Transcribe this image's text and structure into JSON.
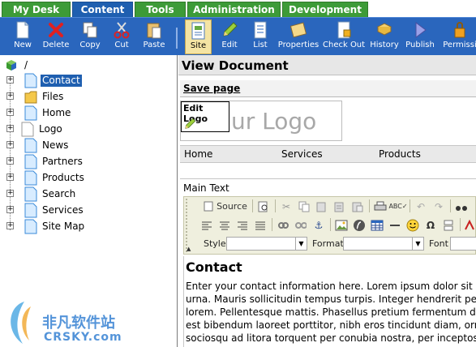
{
  "tabs": [
    {
      "label": "My Desk",
      "active": false
    },
    {
      "label": "Content",
      "active": true
    },
    {
      "label": "Tools",
      "active": false
    },
    {
      "label": "Administration",
      "active": false
    },
    {
      "label": "Development",
      "active": false
    }
  ],
  "toolbar": [
    {
      "label": "New",
      "icon": "new-page-icon"
    },
    {
      "label": "Delete",
      "icon": "delete-icon"
    },
    {
      "label": "Copy",
      "icon": "copy-icon"
    },
    {
      "label": "Cut",
      "icon": "cut-icon"
    },
    {
      "label": "Paste",
      "icon": "paste-icon"
    },
    {
      "label": "Site",
      "icon": "site-icon",
      "active": true
    },
    {
      "label": "Edit",
      "icon": "edit-icon"
    },
    {
      "label": "List",
      "icon": "list-icon"
    },
    {
      "label": "Properties",
      "icon": "properties-icon"
    },
    {
      "label": "Check Out",
      "icon": "check-out-icon"
    },
    {
      "label": "History",
      "icon": "history-icon"
    },
    {
      "label": "Publish",
      "icon": "publish-icon"
    },
    {
      "label": "Permissi",
      "icon": "permissions-icon"
    }
  ],
  "tree": {
    "root_label": "/",
    "items": [
      {
        "label": "Contact",
        "selected": true,
        "type": "page"
      },
      {
        "label": "Files",
        "selected": false,
        "type": "folder"
      },
      {
        "label": "Home",
        "selected": false,
        "type": "page"
      },
      {
        "label": "Logo",
        "selected": false,
        "type": "blank"
      },
      {
        "label": "News",
        "selected": false,
        "type": "page"
      },
      {
        "label": "Partners",
        "selected": false,
        "type": "page"
      },
      {
        "label": "Products",
        "selected": false,
        "type": "page"
      },
      {
        "label": "Search",
        "selected": false,
        "type": "page"
      },
      {
        "label": "Services",
        "selected": false,
        "type": "page"
      },
      {
        "label": "Site Map",
        "selected": false,
        "type": "page"
      }
    ]
  },
  "main": {
    "title": "View Document",
    "save_label": "Save page",
    "edit_logo_label": "Edit Logo",
    "logo_text": "ur Logo",
    "nav": [
      "Home",
      "Services",
      "Products"
    ],
    "main_text_label": "Main Text",
    "editor": {
      "source_label": "Source",
      "style_label": "Style",
      "format_label": "Format",
      "font_label": "Font"
    },
    "content_heading": "Contact",
    "content_lines": [
      "Enter your contact information here. Lorem ipsum dolor sit am",
      "urna. Mauris sollicitudin tempus turpis. Integer hendrerit pede",
      "lorem. Pellentesque mattis. Phasellus pretium fermentum diar",
      "est bibendum laoreet porttitor, nibh eros tincidunt diam, ornare",
      "sociosqu ad litora torquent per conubia nostra, per inceptos hi"
    ]
  },
  "watermark": {
    "cn": "非凡软件站",
    "en": "CRSKY.com"
  },
  "colors": {
    "tab_green": "#3d9b38",
    "tab_active": "#1f5fb0",
    "toolbar_blue": "#2a66bd",
    "selection": "#1f5fb0"
  }
}
